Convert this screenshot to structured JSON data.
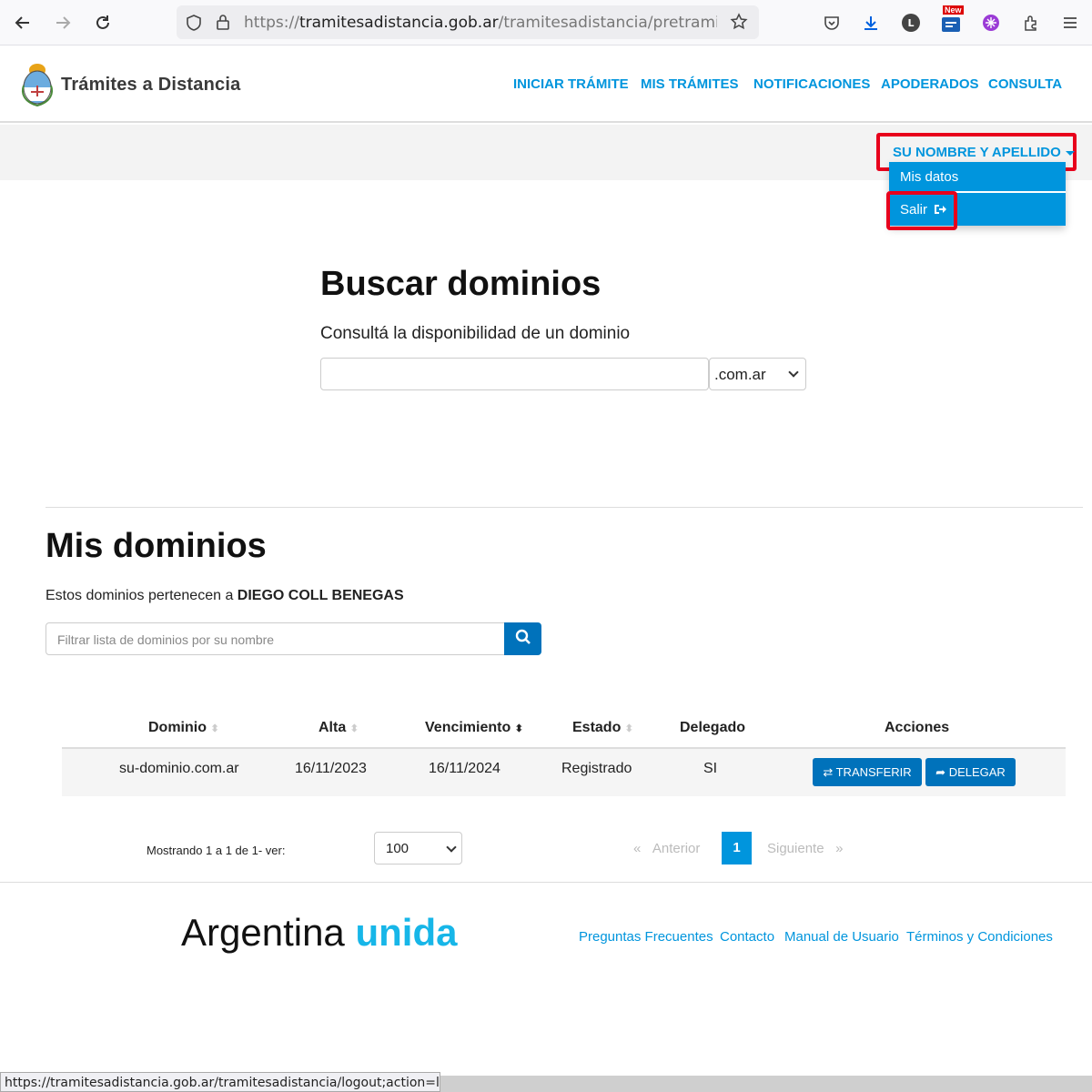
{
  "browser": {
    "url_prefix": "https://",
    "url_host": "tramitesadistancia.gob.ar",
    "url_path": "/tramitesadistancia/pretramite:idTipoTr",
    "badge_new": "New",
    "status_url": "https://tramitesadistancia.gob.ar/tramitesadistancia/logout;action=logout"
  },
  "site": {
    "title": "Trámites a Distancia",
    "nav": [
      "INICIAR TRÁMITE",
      "MIS TRÁMITES",
      "NOTIFICACIONES",
      "APODERADOS",
      "CONSULTA"
    ]
  },
  "user_menu": {
    "label": "SU NOMBRE Y APELLIDO",
    "items": [
      "Mis datos",
      "Salir"
    ]
  },
  "search": {
    "heading": "Buscar dominios",
    "subheading": "Consultá la disponibilidad de un dominio",
    "input_value": "",
    "tld_selected": ".com.ar"
  },
  "my_domains": {
    "heading": "Mis dominios",
    "owner_prefix": "Estos dominios pertenecen a",
    "owner_name": "DIEGO COLL BENEGAS",
    "filter_placeholder": "Filtrar lista de dominios por su nombre",
    "columns": [
      "Dominio",
      "Alta",
      "Vencimiento",
      "Estado",
      "Delegado",
      "Acciones"
    ],
    "rows": [
      {
        "dominio": "su-dominio.com.ar",
        "alta": "16/11/2023",
        "vencimiento": "16/11/2024",
        "estado": "Registrado",
        "delegado": "SI",
        "actions": [
          "TRANSFERIR",
          "DELEGAR"
        ]
      }
    ]
  },
  "pagination": {
    "showing": "Mostrando 1 a 1 de 1- ver:",
    "page_size": "100",
    "prev": "Anterior",
    "next": "Siguiente",
    "current": "1",
    "prev_glyph": "«",
    "next_glyph": "»"
  },
  "footer": {
    "brand_word": "Argentina",
    "brand_accent": "unida",
    "links": [
      "Preguntas Frecuentes",
      "Contacto",
      "Manual de Usuario",
      "Términos y Condiciones"
    ]
  },
  "colors": {
    "accent": "#0095dd",
    "button": "#0072bb",
    "highlight": "#e8001c",
    "brand_accent": "#17b6e8"
  },
  "icons": [
    "back-arrow-icon",
    "forward-arrow-icon",
    "reload-icon",
    "shield-icon",
    "lock-icon",
    "star-icon",
    "pocket-icon",
    "download-icon",
    "account-icon",
    "extension-icon",
    "puzzle-icon",
    "menu-icon",
    "search-icon",
    "transfer-icon",
    "share-icon",
    "logout-icon"
  ]
}
